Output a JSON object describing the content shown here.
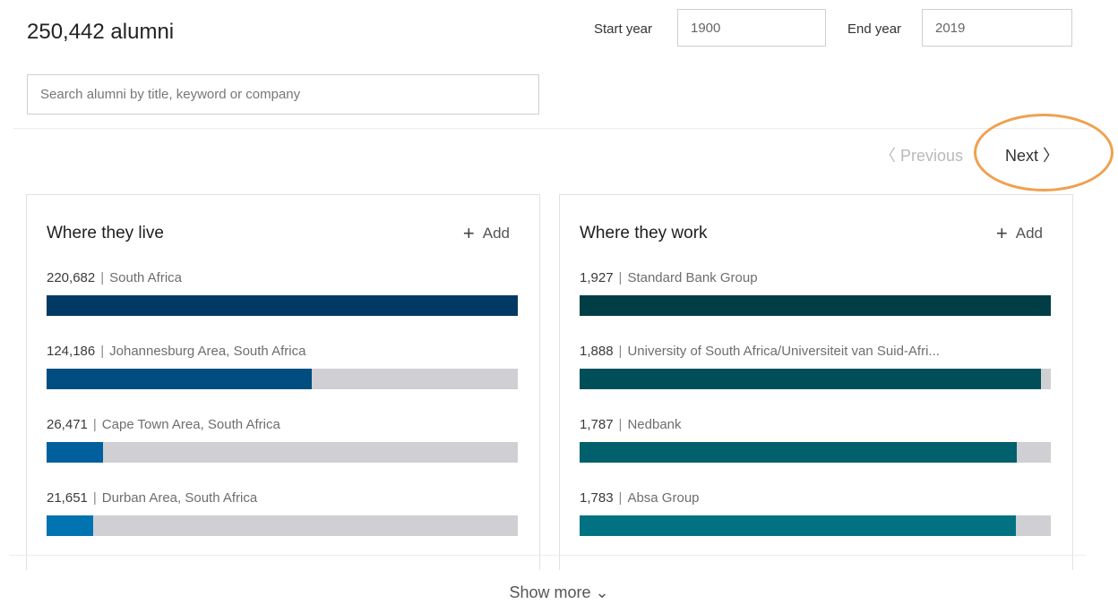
{
  "header": {
    "title": "250,442 alumni",
    "start_year_label": "Start year",
    "start_year_value": "1900",
    "end_year_label": "End year",
    "end_year_value": "2019"
  },
  "search": {
    "placeholder": "Search alumni by title, keyword or company"
  },
  "pagination": {
    "previous_label": "〈 Previous",
    "next_label": "Next 〉"
  },
  "highlight_color": "#f0a050",
  "cards": [
    {
      "title": "Where they live",
      "add_label": "Add",
      "items": [
        {
          "count": "220,682",
          "label": "South Africa",
          "fraction": 1.0,
          "color": "#003a64"
        },
        {
          "count": "124,186",
          "label": "Johannesburg Area, South Africa",
          "fraction": 0.563,
          "color": "#004d80"
        },
        {
          "count": "26,471",
          "label": "Cape Town Area, South Africa",
          "fraction": 0.12,
          "color": "#00609d"
        },
        {
          "count": "21,651",
          "label": "Durban Area, South Africa",
          "fraction": 0.098,
          "color": "#0073b1"
        }
      ]
    },
    {
      "title": "Where they work",
      "add_label": "Add",
      "items": [
        {
          "count": "1,927",
          "label": "Standard Bank Group",
          "fraction": 1.0,
          "color": "#003d45"
        },
        {
          "count": "1,888",
          "label": "University of South Africa/Universiteit van Suid-Afri...",
          "fraction": 0.98,
          "color": "#004f58"
        },
        {
          "count": "1,787",
          "label": "Nedbank",
          "fraction": 0.927,
          "color": "#00606c"
        },
        {
          "count": "1,783",
          "label": "Absa Group",
          "fraction": 0.925,
          "color": "#007281"
        }
      ]
    }
  ],
  "footer": {
    "show_more_label": "Show more ⌄"
  }
}
